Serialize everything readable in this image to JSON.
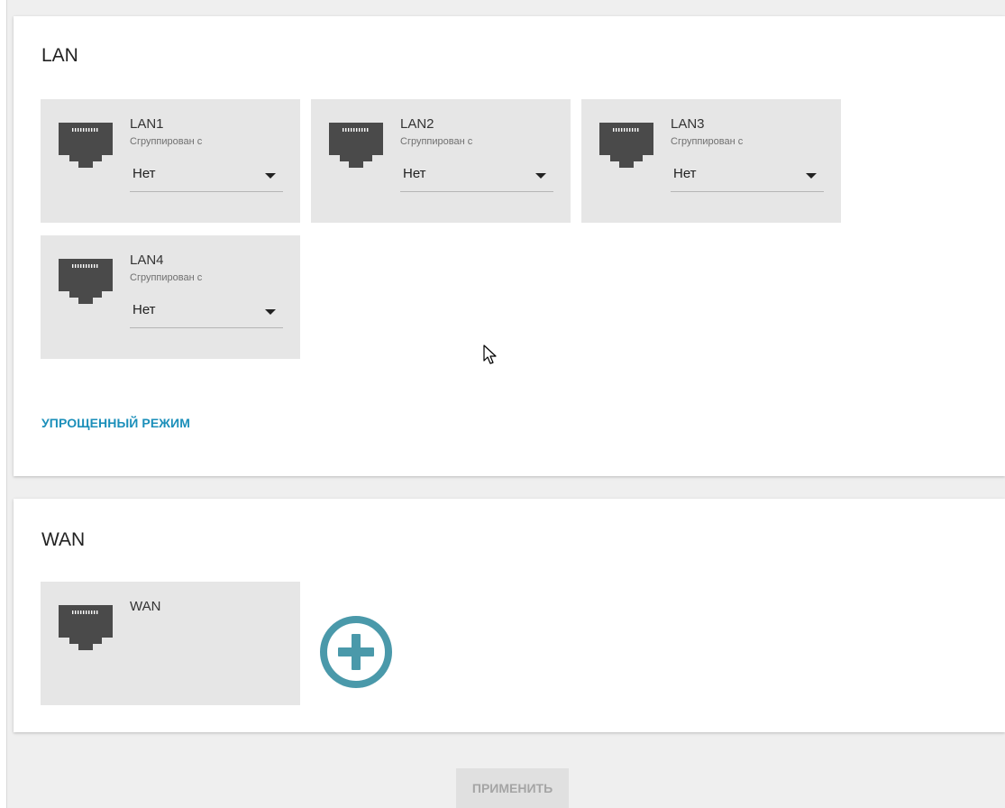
{
  "lan": {
    "title": "LAN",
    "ports": [
      {
        "name": "LAN1",
        "group_label": "Сгруппирован с",
        "group_value": "Нет"
      },
      {
        "name": "LAN2",
        "group_label": "Сгруппирован с",
        "group_value": "Нет"
      },
      {
        "name": "LAN3",
        "group_label": "Сгруппирован с",
        "group_value": "Нет"
      },
      {
        "name": "LAN4",
        "group_label": "Сгруппирован с",
        "group_value": "Нет"
      }
    ],
    "simple_mode_link": "УПРОЩЕННЫЙ РЕЖИМ"
  },
  "wan": {
    "title": "WAN",
    "ports": [
      {
        "name": "WAN"
      }
    ]
  },
  "footer": {
    "apply_label": "ПРИМЕНИТЬ"
  },
  "icons": {
    "port": "ethernet-port-icon",
    "add": "plus-circle-icon",
    "dropdown": "caret-down-icon",
    "cursor": "mouse-pointer-icon"
  },
  "colors": {
    "accent": "#1b8fba",
    "add_button": "#4a99aa",
    "tile_bg": "#e6e6e6",
    "icon_dark": "#4a4a4a",
    "apply_disabled_bg": "#e0e0e0",
    "apply_disabled_text": "#a5a5a5"
  }
}
